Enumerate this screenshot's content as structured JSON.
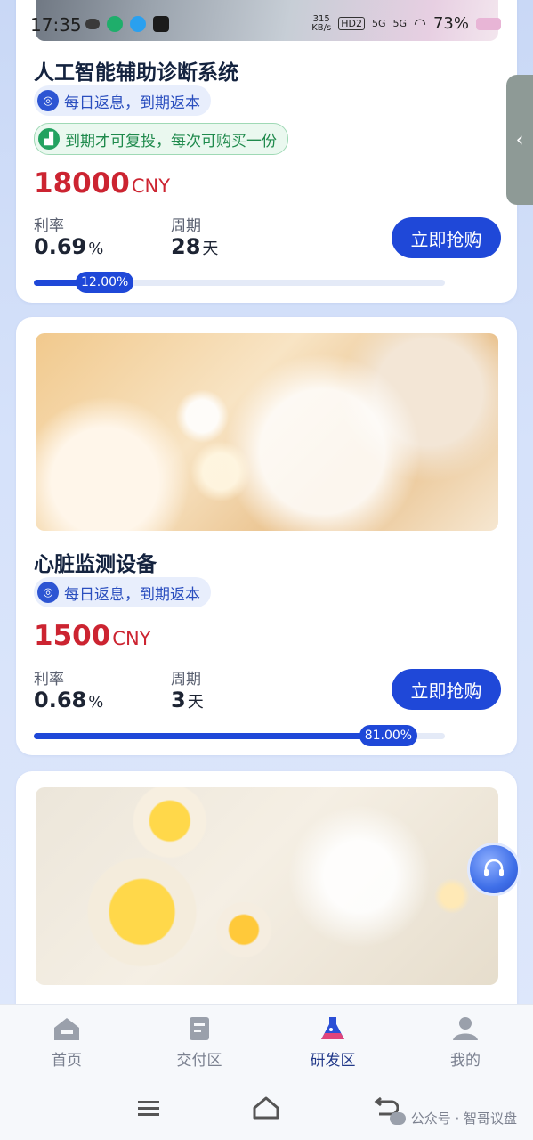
{
  "status_bar": {
    "time": "17:35",
    "net_speed": "315",
    "net_unit": "KB/s",
    "hd": "HD2",
    "sig1": "5G",
    "sig2": "5G",
    "battery": "73%"
  },
  "products": [
    {
      "title": "人工智能辅助诊断系统",
      "tags": [
        "每日返息，到期返本",
        "到期才可复投，每次可购买一份"
      ],
      "price": "18000",
      "currency": "CNY",
      "rate_label": "利率",
      "rate": "0.69",
      "rate_unit": "%",
      "period_label": "周期",
      "period": "28",
      "period_unit": "天",
      "buy_label": "立即抢购",
      "progress_text": "12.00%",
      "progress": 0.12
    },
    {
      "title": "心脏监测设备",
      "tags": [
        "每日返息，到期返本"
      ],
      "price": "1500",
      "currency": "CNY",
      "rate_label": "利率",
      "rate": "0.68",
      "rate_unit": "%",
      "period_label": "周期",
      "period": "3",
      "period_unit": "天",
      "buy_label": "立即抢购",
      "progress_text": "81.00%",
      "progress": 0.81
    }
  ],
  "tabs": [
    {
      "label": "首页",
      "icon": "home-icon"
    },
    {
      "label": "交付区",
      "icon": "delivery-icon"
    },
    {
      "label": "研发区",
      "icon": "flask-icon",
      "active": true
    },
    {
      "label": "我的",
      "icon": "user-icon"
    }
  ],
  "watermark": "公众号 · 智哥议盘",
  "colors": {
    "accent": "#1f48d8",
    "price": "#cc2431",
    "tag_green": "#23a260"
  }
}
